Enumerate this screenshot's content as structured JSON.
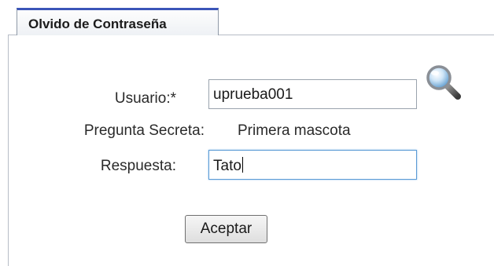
{
  "tab": {
    "title": "Olvido de Contraseña"
  },
  "form": {
    "user_label": "Usuario:*",
    "user_value": "uprueba001",
    "secret_question_label": "Pregunta Secreta:",
    "secret_question_value": "Primera mascota",
    "answer_label": "Respuesta:",
    "answer_value": "Tato",
    "submit_label": "Aceptar"
  },
  "icons": {
    "search": "search-icon"
  },
  "colors": {
    "tab_accent": "#3b55b8",
    "focus_border": "#5b9bd5"
  }
}
